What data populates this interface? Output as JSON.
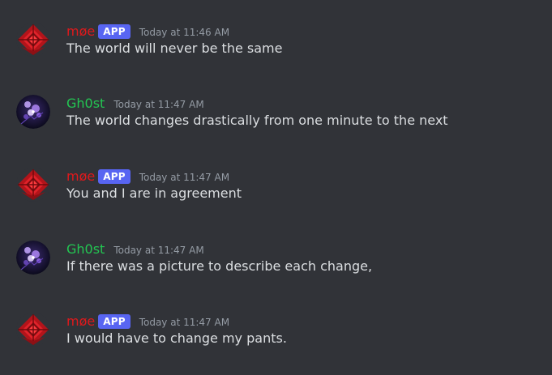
{
  "colors": {
    "background": "#313338",
    "text": "#dbdee1",
    "timestamp": "#949ba4",
    "app_badge_bg": "#5865f2",
    "moe_name": "#e0191c",
    "ghost_name": "#23c552"
  },
  "messages": [
    {
      "author": "møe",
      "author_color": "#e0191c",
      "badge": "APP",
      "avatar_icon": "red-crest-icon",
      "timestamp": "Today at 11:46 AM",
      "text": "The world will never be the same"
    },
    {
      "author": "Gh0st",
      "author_color": "#23c552",
      "badge": "",
      "avatar_icon": "purple-flower-icon",
      "timestamp": "Today at 11:47 AM",
      "text": "The world changes drastically from one minute to the next"
    },
    {
      "author": "møe",
      "author_color": "#e0191c",
      "badge": "APP",
      "avatar_icon": "red-crest-icon",
      "timestamp": "Today at 11:47 AM",
      "text": "You and I are in agreement"
    },
    {
      "author": "Gh0st",
      "author_color": "#23c552",
      "badge": "",
      "avatar_icon": "purple-flower-icon",
      "timestamp": "Today at 11:47 AM",
      "text": "If there was a picture to describe each change,"
    },
    {
      "author": "møe",
      "author_color": "#e0191c",
      "badge": "APP",
      "avatar_icon": "red-crest-icon",
      "timestamp": "Today at 11:47 AM",
      "text": "I would have to change my pants."
    }
  ]
}
